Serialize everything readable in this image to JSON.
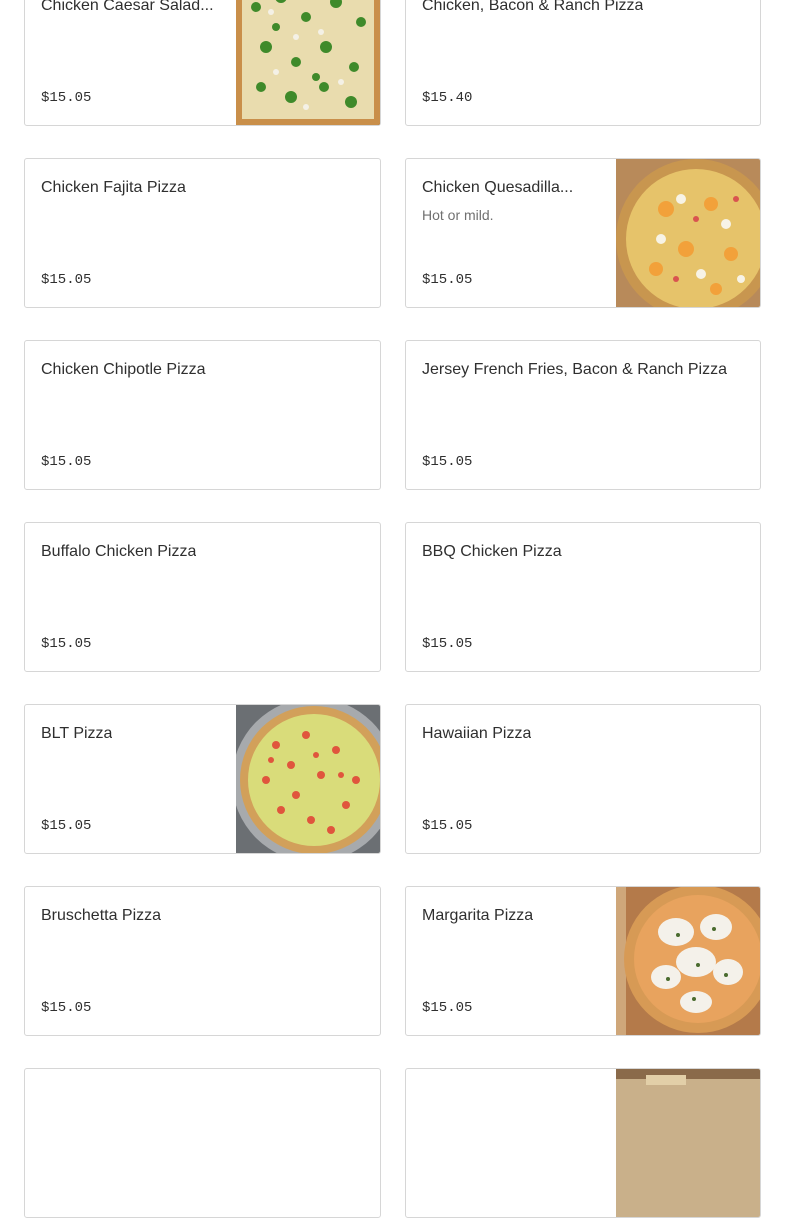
{
  "menu": {
    "items": [
      {
        "name": "Chicken Caesar Salad...",
        "price": "$15.05",
        "image": "caesar-pizza-photo"
      },
      {
        "name": "Chicken, Bacon & Ranch Pizza",
        "price": "$15.40"
      },
      {
        "name": "Chicken Fajita Pizza",
        "price": "$15.05"
      },
      {
        "name": "Chicken Quesadilla...",
        "description": "Hot or mild.",
        "price": "$15.05",
        "image": "quesadilla-pizza-photo"
      },
      {
        "name": "Chicken Chipotle Pizza",
        "price": "$15.05"
      },
      {
        "name": "Jersey French Fries, Bacon & Ranch Pizza",
        "price": "$15.05"
      },
      {
        "name": "Buffalo Chicken Pizza",
        "price": "$15.05"
      },
      {
        "name": "BBQ Chicken Pizza",
        "price": "$15.05"
      },
      {
        "name": "BLT Pizza",
        "price": "$15.05",
        "image": "blt-pizza-photo"
      },
      {
        "name": "Hawaiian Pizza",
        "price": "$15.05"
      },
      {
        "name": "Bruschetta Pizza",
        "price": "$15.05"
      },
      {
        "name": "Margarita Pizza",
        "price": "$15.05",
        "image": "margarita-pizza-photo"
      },
      {
        "name": "",
        "price": ""
      },
      {
        "name": "",
        "price": "",
        "image": "pizza-photo"
      }
    ]
  }
}
